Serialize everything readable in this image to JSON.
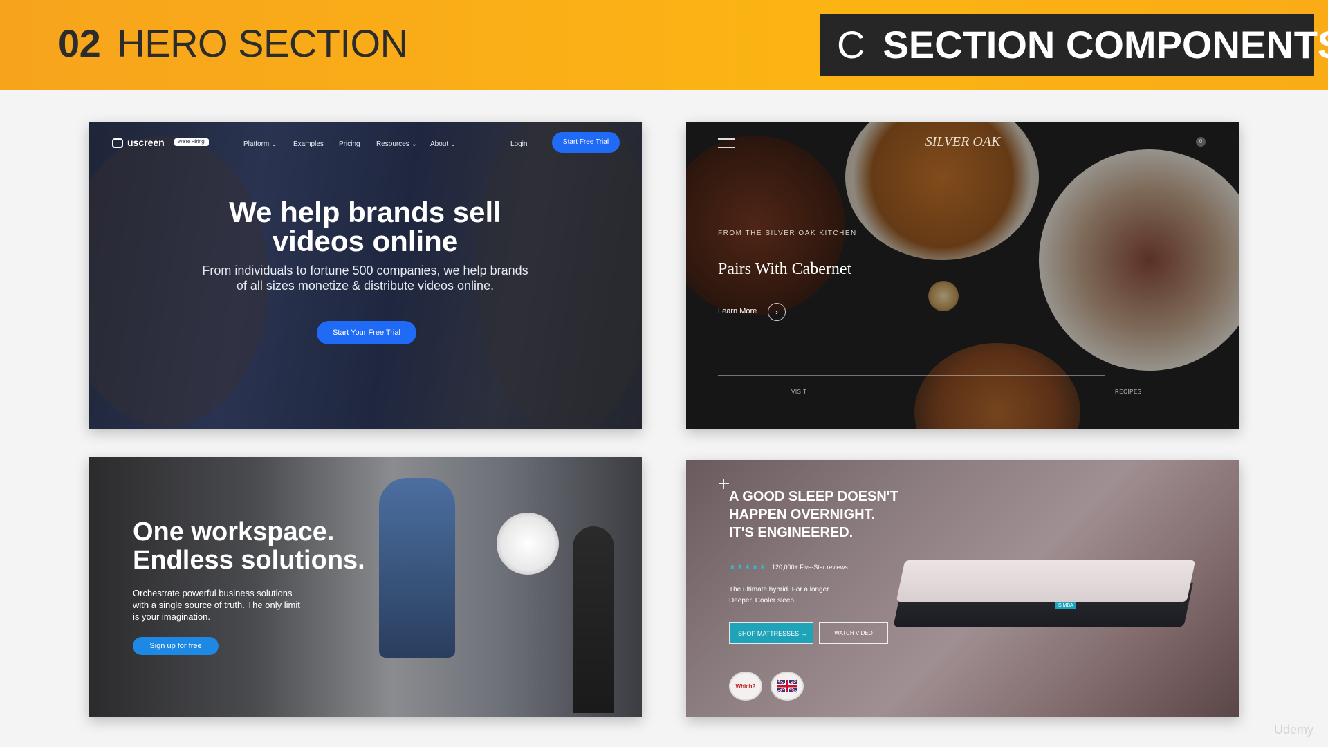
{
  "banner": {
    "number": "02",
    "title": "HERO SECTION",
    "section_letter": "C",
    "section_title": "SECTION COMPONENTS"
  },
  "card1": {
    "logo": "uscreen",
    "hiring_badge": "We're Hiring!",
    "nav": [
      "Platform ⌄",
      "Examples",
      "Pricing",
      "Resources ⌄",
      "About ⌄"
    ],
    "login": "Login",
    "start_trial": "Start Free Trial",
    "headline_line1": "We help brands sell",
    "headline_line2": "videos online",
    "subtitle_line1": "From individuals to fortune 500 companies, we help brands",
    "subtitle_line2": "of all sizes monetize & distribute videos online.",
    "cta": "Start Your Free Trial"
  },
  "card2": {
    "logo": "SILVER OAK",
    "cart_count": "0",
    "eyebrow": "FROM THE SILVER OAK KITCHEN",
    "title": "Pairs With Cabernet",
    "learn_more": "Learn More",
    "arrow": "›",
    "tabs": [
      "VISIT",
      "RECIPES"
    ]
  },
  "card3": {
    "headline_line1": "One workspace.",
    "headline_line2": "Endless solutions.",
    "subtitle": "Orchestrate powerful business solutions with a single source of truth. The only limit is your imagination.",
    "cta": "Sign up for free"
  },
  "card4": {
    "headline_line1": "A GOOD SLEEP DOESN'T",
    "headline_line2": "HAPPEN OVERNIGHT.",
    "headline_line3": "IT'S ENGINEERED.",
    "stars": "★★★★★",
    "reviews": "120,000+ Five-Star reviews.",
    "desc_line1": "The ultimate hybrid. For a longer.",
    "desc_line2": "Deeper. Cooler sleep.",
    "shop_button": "SHOP MATTRESSES →",
    "watch_button": "WATCH VIDEO",
    "badge1": "Which?",
    "brand": "SIMBA"
  },
  "watermark": "Udemy",
  "colors": {
    "banner": "#fbb414",
    "dark_panel": "#262626",
    "uscreen_blue": "#1f6bf5",
    "simba_teal": "#1ea3b8"
  }
}
